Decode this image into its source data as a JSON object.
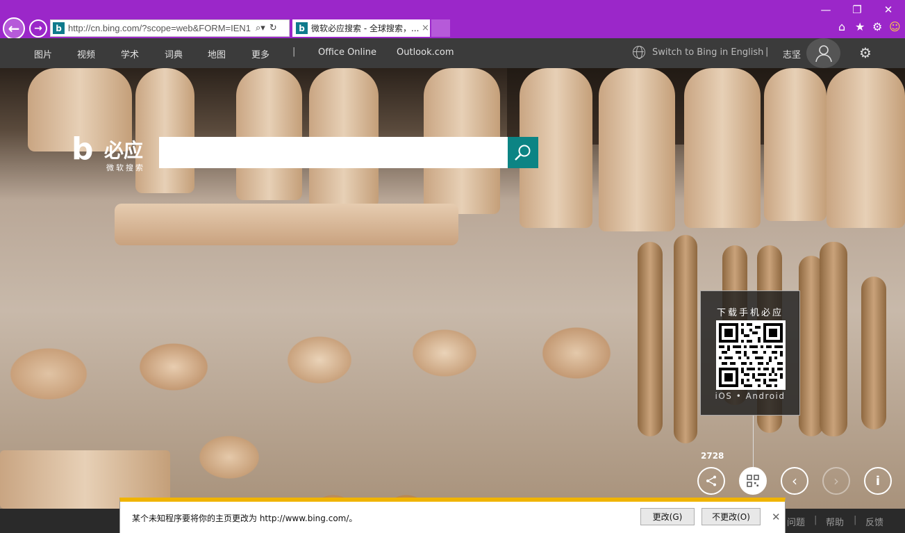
{
  "browser": {
    "url": "http://cn.bing.com/?scope=web&FORM=IEN1",
    "tab_title": "微软必应搜索 - 全球搜索，...",
    "tab_close": "×"
  },
  "nav": {
    "links": [
      "图片",
      "视频",
      "学术",
      "词典",
      "地图",
      "更多"
    ],
    "external": [
      "Office Online",
      "Outlook.com"
    ],
    "switch_lang": "Switch to Bing in English",
    "username": "志坚"
  },
  "logo": {
    "mark": "b",
    "name": "必应",
    "subtitle": "微软搜索"
  },
  "search": {
    "placeholder": ""
  },
  "qr": {
    "title": "下载手机必应",
    "platforms": "iOS • Android"
  },
  "share_count": "2728",
  "footer": {
    "links": [
      "问题",
      "帮助",
      "反馈"
    ]
  },
  "notification": {
    "message": "某个未知程序要将你的主页更改为 http://www.bing.com/。",
    "change_button": "更改(G)",
    "keep_button": "不更改(O)"
  },
  "colors": {
    "title_bar": "#9b27c9",
    "search_button": "#0c8484",
    "notify_accent": "#f0b400"
  }
}
